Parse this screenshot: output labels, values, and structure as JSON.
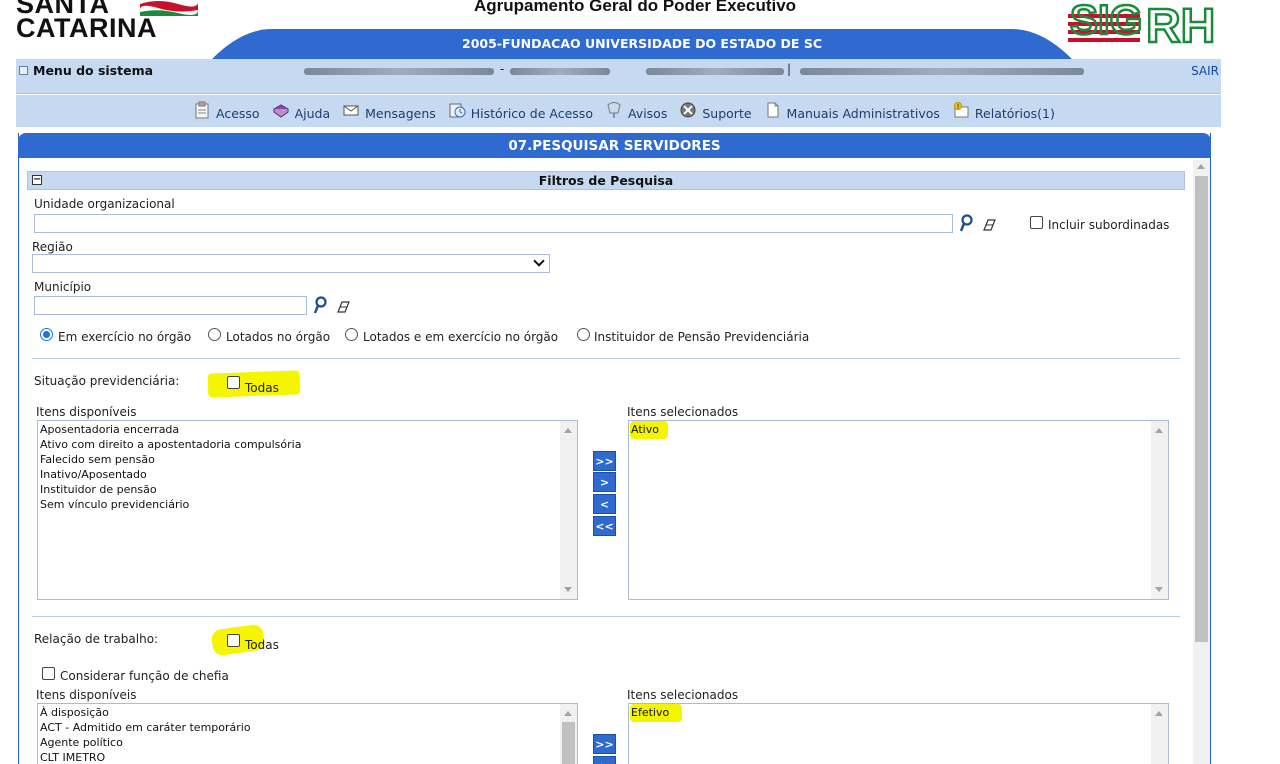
{
  "header": {
    "state_logo_line1": "SANTA",
    "state_logo_line2": "CATARINA",
    "title": "Agrupamento Geral do Poder Executivo",
    "organization": "2005-FUNDACAO UNIVERSIDADE DO ESTADO DE SC",
    "system_logo": "SIGRH"
  },
  "menubar": {
    "menu_label": "Menu do sistema",
    "sep1": "-",
    "sep2": "|",
    "logout_label": "SAIR"
  },
  "toolbar": {
    "items": [
      {
        "label": "Acesso",
        "icon": "clipboard-icon"
      },
      {
        "label": "Ajuda",
        "icon": "help-book-icon"
      },
      {
        "label": "Mensagens",
        "icon": "envelope-icon"
      },
      {
        "label": "Histórico de Acesso",
        "icon": "history-icon"
      },
      {
        "label": "Avisos",
        "icon": "notice-icon"
      },
      {
        "label": "Suporte",
        "icon": "support-icon"
      },
      {
        "label": "Manuais Administrativos",
        "icon": "document-icon"
      },
      {
        "label": "Relatórios(1)",
        "icon": "reports-icon"
      }
    ]
  },
  "page": {
    "title": "07.PESQUISAR SERVIDORES",
    "filters_title": "Filtros de Pesquisa"
  },
  "filters": {
    "unidade_label": "Unidade organizacional",
    "unidade_value": "",
    "incluir_subordinadas_label": "Incluir subordinadas",
    "incluir_subordinadas_checked": false,
    "regiao_label": "Região",
    "regiao_value": "",
    "municipio_label": "Município",
    "municipio_value": "",
    "vinculo_options": [
      {
        "label": "Em exercício no órgão",
        "selected": true
      },
      {
        "label": "Lotados no órgão",
        "selected": false
      },
      {
        "label": "Lotados e em exercício no órgão",
        "selected": false
      },
      {
        "label": "Instituidor de Pensão Previdenciária",
        "selected": false
      }
    ]
  },
  "situacao": {
    "label": "Situação previdenciária:",
    "todas_label": "Todas",
    "todas_checked": false,
    "available_title": "Itens disponíveis",
    "selected_title": "Itens selecionados",
    "available": [
      "Aposentadoria encerrada",
      "Ativo com direito a apostentadoria compulsória",
      "Falecido sem pensão",
      "Inativo/Aposentado",
      "Instituidor de pensão",
      "Sem vínculo previdenciário"
    ],
    "selected": [
      "Ativo"
    ]
  },
  "relacao": {
    "label": "Relação de trabalho:",
    "todas_label": "Todas",
    "todas_checked": false,
    "considerar_chefia_label": "Considerar função de chefia",
    "considerar_chefia_checked": false,
    "available_title": "Itens disponíveis",
    "selected_title": "Itens selecionados",
    "available": [
      "À disposição",
      "ACT - Admitido em caráter temporário",
      "Agente político",
      "CLT IMETRO"
    ],
    "selected": [
      "Efetivo"
    ]
  },
  "move_buttons": {
    "add_all": ">>",
    "add": ">",
    "remove": "<",
    "remove_all": "<<"
  },
  "colors": {
    "primary_blue": "#2f6ad0",
    "light_blue": "#c5daf0",
    "highlight": "#f5f500",
    "sigrh_red": "#c8102e",
    "sigrh_green": "#1b8a3a"
  }
}
